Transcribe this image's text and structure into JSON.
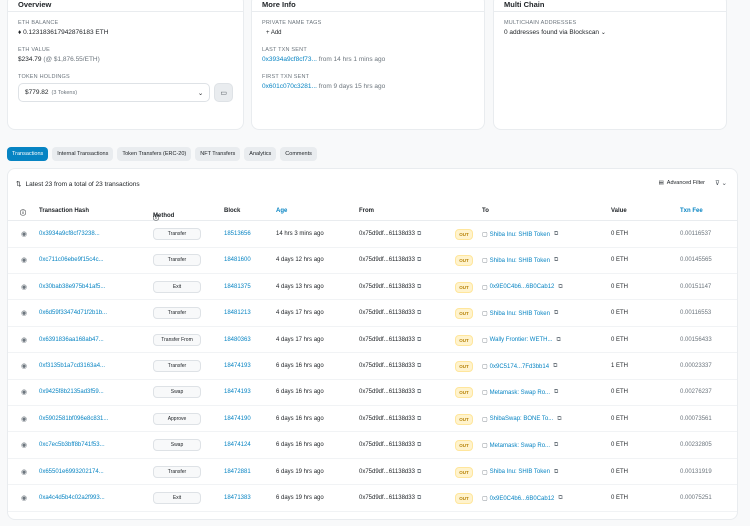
{
  "overview": {
    "title": "Overview",
    "eth_balance_label": "ETH BALANCE",
    "eth_balance": "0.123183617942876183 ETH",
    "eth_value_label": "ETH VALUE",
    "eth_value": "$234.79",
    "eth_value_rate": "(@ $1,876.55/ETH)",
    "token_holdings_label": "TOKEN HOLDINGS",
    "token_holdings_value": "$779.82",
    "token_holdings_count": "(3 Tokens)",
    "dropdown_icon": "chevron-down-icon",
    "wallet_icon": "wallet-icon"
  },
  "more_info": {
    "title": "More Info",
    "private_tag_label": "PRIVATE NAME TAGS",
    "add_label": "+ Add",
    "last_txn_label": "LAST TXN SENT",
    "last_txn_hash": "0x3934a9cf8cf73...",
    "last_txn_time": "from 14 hrs 1 mins ago",
    "first_txn_label": "FIRST TXN SENT",
    "first_txn_hash": "0x601c070c3281...",
    "first_txn_time": "from 9 days 15 hrs ago"
  },
  "multichain": {
    "title": "Multi Chain",
    "addresses_label": "MULTICHAIN ADDRESSES",
    "addresses_value": "0 addresses found via",
    "blockscan": "Blockscan"
  },
  "tabs": [
    {
      "label": "Transactions",
      "active": true
    },
    {
      "label": "Internal Transactions",
      "active": false
    },
    {
      "label": "Token Transfers (ERC-20)",
      "active": false
    },
    {
      "label": "NFT Transfers",
      "active": false
    },
    {
      "label": "Analytics",
      "active": false
    },
    {
      "label": "Comments",
      "active": false
    }
  ],
  "table": {
    "summary": "Latest 23 from a total of 23 transactions",
    "summary_icon": "sort-icon",
    "advanced_filter": "Advanced Filter",
    "filter_icon": "filter-icon",
    "columns": {
      "hash": "Transaction Hash",
      "method": "Method",
      "block": "Block",
      "age": "Age",
      "from": "From",
      "to": "To",
      "value": "Value",
      "fee": "Txn Fee"
    },
    "rows": [
      {
        "hash": "0x3934a9cf8cf73238...",
        "method": "Transfer",
        "block": "18513656",
        "age": "14 hrs 3 mins ago",
        "from": "0x75d9df...61138d33",
        "dir": "OUT",
        "to": "Shiba Inu: SHIB Token",
        "value": "0 ETH",
        "fee": "0.00116537"
      },
      {
        "hash": "0xc711c06ebe9f15c4c...",
        "method": "Transfer",
        "block": "18481600",
        "age": "4 days 12 hrs ago",
        "from": "0x75d9df...61138d33",
        "dir": "OUT",
        "to": "Shiba Inu: SHIB Token",
        "value": "0 ETH",
        "fee": "0.00145565"
      },
      {
        "hash": "0x30bab38e975b41af5...",
        "method": "Exit",
        "block": "18481375",
        "age": "4 days 13 hrs ago",
        "from": "0x75d9df...61138d33",
        "dir": "OUT",
        "to": "0x9E0C4b6...6B0Cab12",
        "value": "0 ETH",
        "fee": "0.00151147"
      },
      {
        "hash": "0x6d59f33474d71f2b1b...",
        "method": "Transfer",
        "block": "18481213",
        "age": "4 days 17 hrs ago",
        "from": "0x75d9df...61138d33",
        "dir": "OUT",
        "to": "Shiba Inu: SHIB Token",
        "value": "0 ETH",
        "fee": "0.00116553"
      },
      {
        "hash": "0x6391836aa168ab47...",
        "method": "Transfer From",
        "block": "18480363",
        "age": "4 days 17 hrs ago",
        "from": "0x75d9df...61138d33",
        "dir": "OUT",
        "to": "Wally Frontier: WETH...",
        "value": "0 ETH",
        "fee": "0.00156433"
      },
      {
        "hash": "0xf3135b1a7cd3163a4...",
        "method": "Transfer",
        "block": "18474193",
        "age": "6 days 16 hrs ago",
        "from": "0x75d9df...61138d33",
        "dir": "OUT",
        "to": "0x9C5174...7Fd3bb14",
        "value": "1 ETH",
        "fee": "0.00023337"
      },
      {
        "hash": "0x9425f8b2135ad3f59...",
        "method": "Swap",
        "block": "18474193",
        "age": "6 days 16 hrs ago",
        "from": "0x75d9df...61138d33",
        "dir": "OUT",
        "to": "Metamask: Swap Ro...",
        "value": "0 ETH",
        "fee": "0.00276237"
      },
      {
        "hash": "0x5902581bf096e8c831...",
        "method": "Approve",
        "block": "18474190",
        "age": "6 days 16 hrs ago",
        "from": "0x75d9df...61138d33",
        "dir": "OUT",
        "to": "ShibaSwap: BONE To...",
        "value": "0 ETH",
        "fee": "0.00073561"
      },
      {
        "hash": "0xc7ec5b3bff8b741f53...",
        "method": "Swap",
        "block": "18474124",
        "age": "6 days 16 hrs ago",
        "from": "0x75d9df...61138d33",
        "dir": "OUT",
        "to": "Metamask: Swap Ro...",
        "value": "0 ETH",
        "fee": "0.00232805"
      },
      {
        "hash": "0x65501e6993202174...",
        "method": "Transfer",
        "block": "18472881",
        "age": "6 days 19 hrs ago",
        "from": "0x75d9df...61138d33",
        "dir": "OUT",
        "to": "Shiba Inu: SHIB Token",
        "value": "0 ETH",
        "fee": "0.00131919"
      },
      {
        "hash": "0xa4c4d5b4c02a2f993...",
        "method": "Exit",
        "block": "18471383",
        "age": "6 days 19 hrs ago",
        "from": "0x75d9df...61138d33",
        "dir": "OUT",
        "to": "0x9E0C4b6...6B0Cab12",
        "value": "0 ETH",
        "fee": "0.00075251"
      }
    ]
  }
}
